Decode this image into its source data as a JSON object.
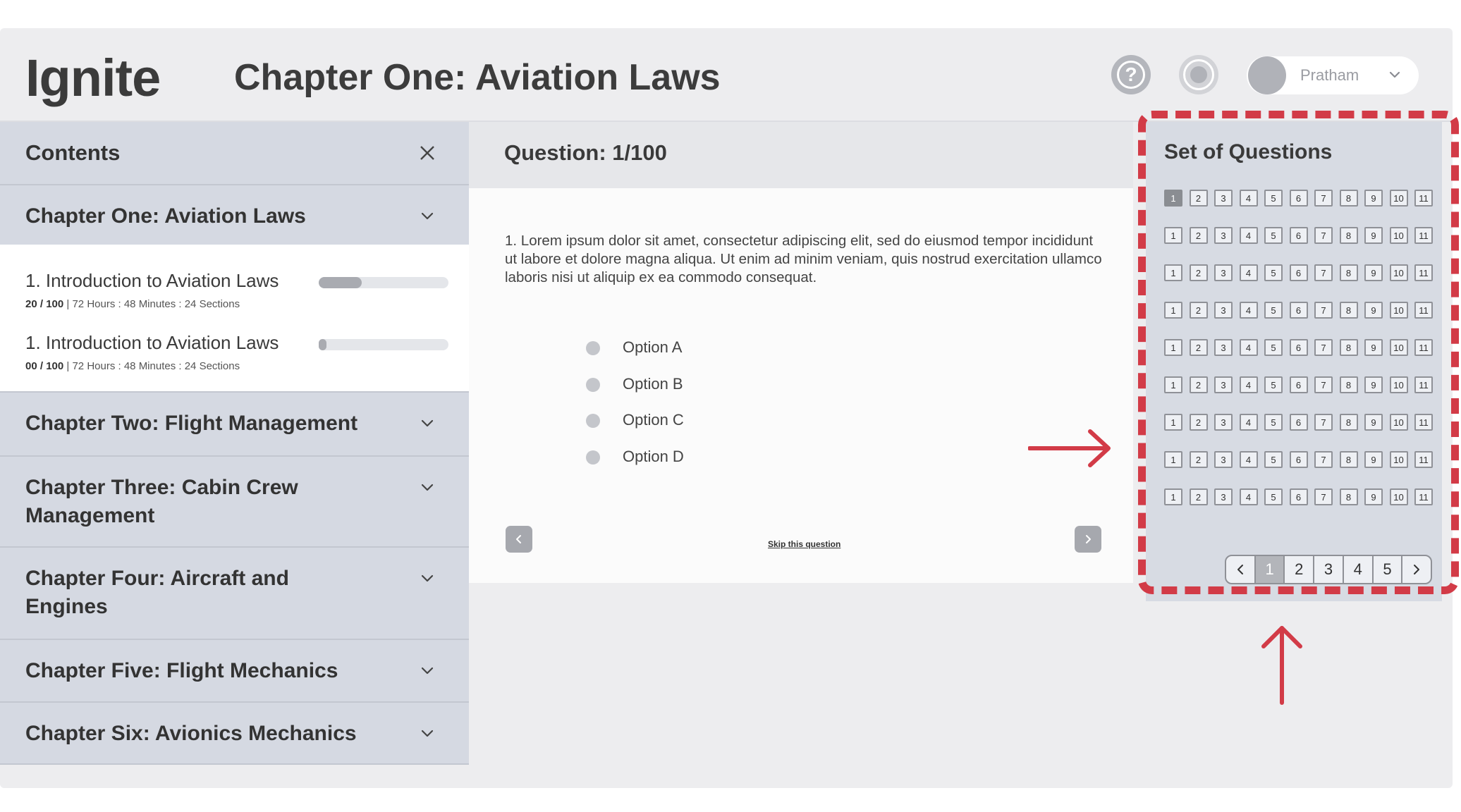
{
  "header": {
    "logo": "Ignite",
    "title": "Chapter One: Aviation Laws",
    "user_name": "Pratham",
    "help_icon_glyph": "?"
  },
  "sidebar": {
    "heading": "Contents",
    "chapters": [
      {
        "title": "Chapter One: Aviation Laws",
        "expanded": true
      },
      {
        "title": "Chapter Two: Flight Management"
      },
      {
        "title": "Chapter Three: Cabin Crew Management"
      },
      {
        "title": "Chapter Four: Aircraft and Engines"
      },
      {
        "title": "Chapter Five: Flight Mechanics"
      },
      {
        "title": "Chapter Six: Avionics Mechanics"
      }
    ],
    "lessons": [
      {
        "title": "1. Introduction to Aviation Laws",
        "score": "20",
        "total": "100",
        "meta": "72 Hours : 48 Minutes : 24 Sections",
        "progress": 0.33
      },
      {
        "title": "1. Introduction to Aviation Laws",
        "score": "00",
        "total": "100",
        "meta": "72 Hours : 48 Minutes : 24 Sections",
        "progress": 0.06
      }
    ]
  },
  "question": {
    "title": "Question: 1/100",
    "text": "1. Lorem ipsum dolor sit amet, consectetur adipiscing elit, sed do eiusmod tempor incididunt ut labore et dolore magna aliqua. Ut enim ad minim veniam, quis nostrud exercitation ullamco laboris nisi ut aliquip ex ea commodo consequat.",
    "options": [
      "Option A",
      "Option B",
      "Option C",
      "Option D"
    ],
    "skip_label": "Skip this question"
  },
  "question_set": {
    "title": "Set of Questions",
    "row_count": 9,
    "numbers": [
      "1",
      "2",
      "3",
      "4",
      "5",
      "6",
      "7",
      "8",
      "9",
      "10",
      "11"
    ],
    "active_question": "1",
    "pages": [
      "1",
      "2",
      "3",
      "4",
      "5"
    ],
    "active_page": "1"
  },
  "colors": {
    "annotation": "#d23b47",
    "sidebar_bg": "#d5d9e2",
    "panel_bg": "#ededef"
  }
}
